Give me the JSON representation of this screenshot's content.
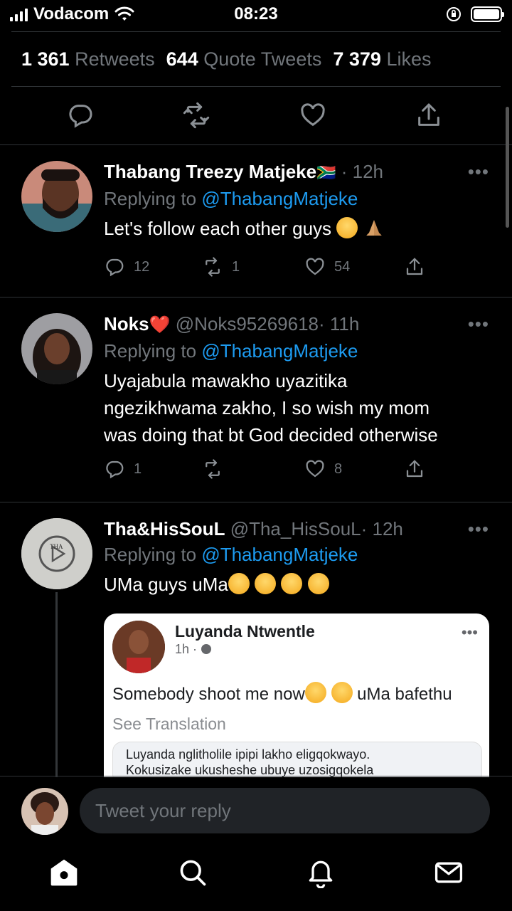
{
  "status_bar": {
    "carrier": "Vodacom",
    "time": "08:23"
  },
  "stats": {
    "retweets_count": "1 361",
    "retweets_label": "Retweets",
    "quotes_count": "644",
    "quotes_label": "Quote Tweets",
    "likes_count": "7 379",
    "likes_label": "Likes"
  },
  "tweets": [
    {
      "name": "Thabang Treezy Matjeke",
      "flag": "🇿🇦",
      "handle": "",
      "time": "· 12h",
      "replying_prefix": "Replying to ",
      "replying_handle": "@ThabangMatjeke",
      "text": "Let's follow each other guys",
      "replies": "12",
      "retweets": "1",
      "likes": "54"
    },
    {
      "name": "Noks",
      "heart": "❤️",
      "handle": "@Noks95269618",
      "time": "· 11h",
      "replying_prefix": "Replying to ",
      "replying_handle": "@ThabangMatjeke",
      "text_line1": "Uyajabula mawakho uyazitika",
      "text_line2": "ngezikhwama zakho, I so wish my mom",
      "text_line3": "was doing that bt God decided otherwise",
      "replies": "1",
      "retweets": "",
      "likes": "8"
    },
    {
      "name": "Tha&HisSouL",
      "handle": "@Tha_HisSouL",
      "time": "· 12h",
      "replying_prefix": "Replying to ",
      "replying_handle": "@ThabangMatjeke",
      "text": "UMa guys uMa",
      "avatar_text": "THA"
    }
  ],
  "quote": {
    "name": "Luyanda Ntwentle",
    "time": "1h ·",
    "text_before": "Somebody shoot me now",
    "text_after": "uMa bafethu",
    "see_translation": "See Translation",
    "comment_line1": "Luyanda nglitholile ipipi lakho eligqokwayo.",
    "comment_line2": "Kokusizake ukusheshe ubuye uzosigqokela"
  },
  "reply_bar": {
    "placeholder": "Tweet your reply"
  },
  "colors": {
    "background": "#000000",
    "accent": "#1d9bf0",
    "muted": "#71767b",
    "divider": "#2f3336"
  },
  "icons": [
    "wifi-icon",
    "battery-icon",
    "reply-icon",
    "retweet-icon",
    "like-icon",
    "share-icon",
    "more-icon",
    "home-icon",
    "search-icon",
    "notifications-icon",
    "messages-icon"
  ]
}
